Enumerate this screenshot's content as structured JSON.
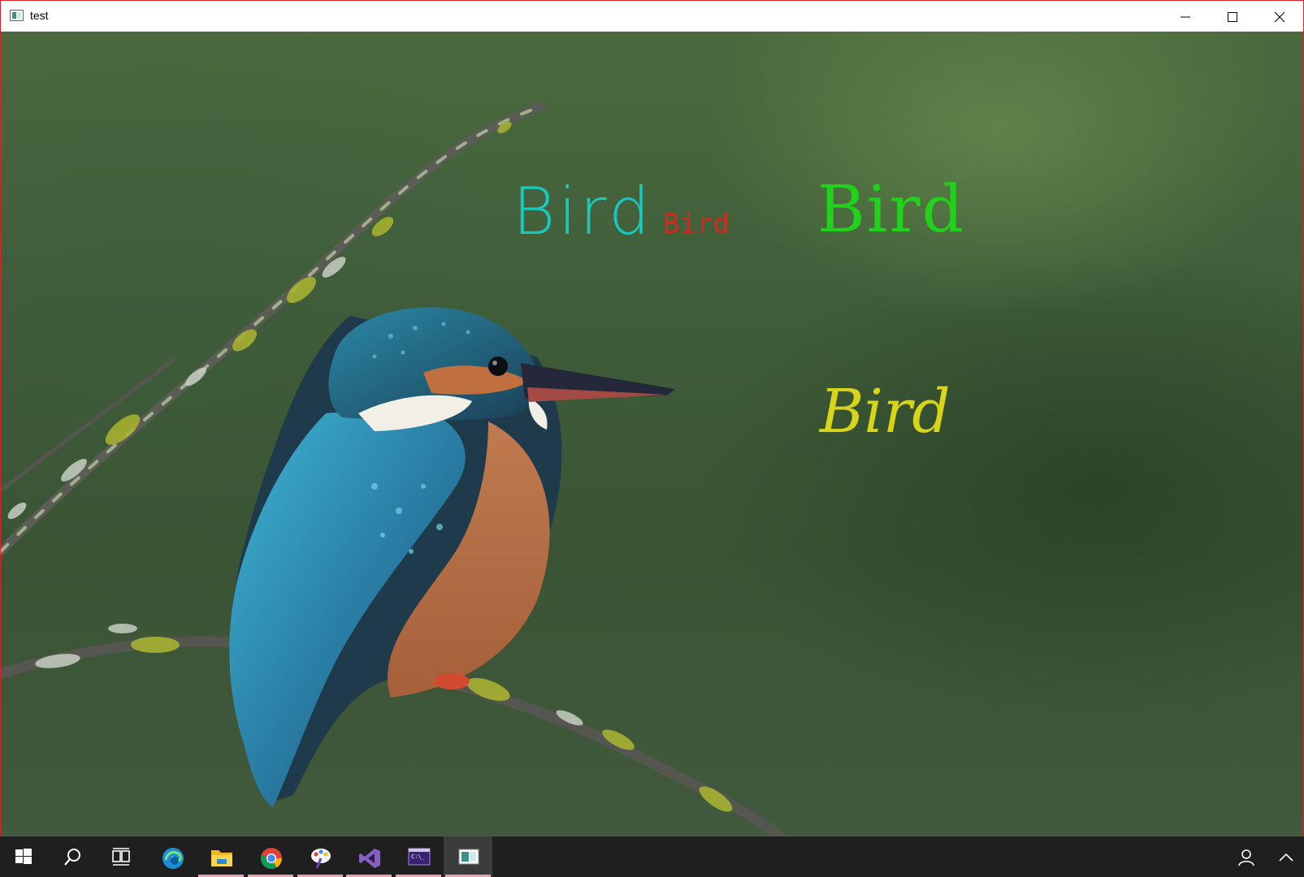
{
  "window": {
    "title": "test",
    "icon": "app-window-icon",
    "buttons": [
      "minimize-icon",
      "maximize-icon",
      "close-icon"
    ]
  },
  "canvas": {
    "labels": [
      {
        "text": "Bird",
        "color": "#17cfc8"
      },
      {
        "text": "Bird",
        "color": "#d32a1e"
      },
      {
        "text": "Bird",
        "color": "#20d21b"
      },
      {
        "text": "Bird",
        "color": "#d8d41a"
      }
    ]
  },
  "taskbar": {
    "items": [
      {
        "icon": "windows-start-icon"
      },
      {
        "icon": "search-icon"
      },
      {
        "icon": "task-view-icon"
      },
      {
        "icon": "edge-icon"
      },
      {
        "icon": "file-explorer-icon",
        "running": true
      },
      {
        "icon": "chrome-icon",
        "running": true
      },
      {
        "icon": "paint-icon",
        "running": true
      },
      {
        "icon": "visual-studio-icon",
        "running": true
      },
      {
        "icon": "terminal-icon",
        "running": true
      },
      {
        "icon": "test-app-icon",
        "running": true,
        "active": true
      }
    ],
    "tray": [
      "people-icon",
      "chevron-up-icon"
    ]
  }
}
